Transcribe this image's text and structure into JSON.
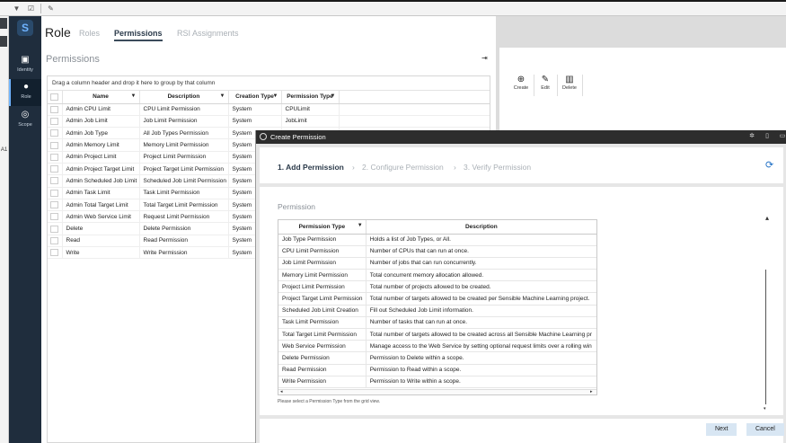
{
  "role": {
    "title": "Role",
    "tabs": [
      "Roles",
      "Permissions",
      "RSI Assignments"
    ],
    "active_tab": "Permissions",
    "section_title": "Permissions",
    "group_hint": "Drag a column header and drop it here to group by that column",
    "columns": [
      "Name",
      "Description",
      "Creation Type",
      "Permission Type"
    ],
    "rows": [
      [
        "Admin CPU Limit",
        "CPU Limit Permission",
        "System",
        "CPULimit"
      ],
      [
        "Admin Job Limit",
        "Job Limit Permission",
        "System",
        "JobLimit"
      ],
      [
        "Admin Job Type",
        "All Job Types Permission",
        "System",
        ""
      ],
      [
        "Admin Memory Limit",
        "Memory Limit Permission",
        "System",
        ""
      ],
      [
        "Admin Project Limit",
        "Project Limit Permission",
        "System",
        ""
      ],
      [
        "Admin Project Target Limit",
        "Project Target Limit Permission",
        "System",
        ""
      ],
      [
        "Admin Scheduled Job Limit",
        "Scheduled Job Limit Permission",
        "System",
        ""
      ],
      [
        "Admin Task Limit",
        "Task Limit Permission",
        "System",
        ""
      ],
      [
        "Admin Total Target Limit",
        "Total Target Limit Permission",
        "System",
        ""
      ],
      [
        "Admin Web Service Limit",
        "Request Limit Permission",
        "System",
        ""
      ],
      [
        "Delete",
        "Delete Permission",
        "System",
        ""
      ],
      [
        "Read",
        "Read Permission",
        "System",
        ""
      ],
      [
        "Write",
        "Write Permission",
        "System",
        ""
      ]
    ]
  },
  "sidebar": {
    "items": [
      {
        "label": "Identity",
        "icon": "identity-icon"
      },
      {
        "label": "Role",
        "icon": "user-icon"
      },
      {
        "label": "Scope",
        "icon": "scope-icon"
      }
    ]
  },
  "actions": {
    "create": "Create",
    "edit": "Edit",
    "delete": "Delete"
  },
  "dialog": {
    "title": "Create Permission",
    "steps": [
      "1. Add Permission",
      "2. Configure Permission",
      "3. Verify Permission"
    ],
    "section_title": "Permission",
    "columns": [
      "Permission Type",
      "Description"
    ],
    "rows": [
      [
        "Job Type Permission",
        "Holds a list of Job Types, or All."
      ],
      [
        "CPU Limit Permission",
        "Number of CPUs that can run at once."
      ],
      [
        "Job Limit Permission",
        "Number of jobs that can run concurrently."
      ],
      [
        "Memory Limit Permission",
        "Total concurrent memory allocation allowed."
      ],
      [
        "Project Limit Permission",
        "Total number of projects allowed to be created."
      ],
      [
        "Project Target Limit Permission",
        "Total number of targets allowed to be created per Sensible Machine Learning project."
      ],
      [
        "Scheduled Job Limit Creation",
        "Fill out Scheduled Job Limit information."
      ],
      [
        "Task Limit Permission",
        "Number of tasks that can run at once."
      ],
      [
        "Total Target Limit Permission",
        "Total number of targets allowed to be created across all Sensible Machine Learning pr"
      ],
      [
        "Web Service Permission",
        "Manage access to the Web Service by setting optional request limits over a rolling win"
      ],
      [
        "Delete Permission",
        "Permission to Delete within a scope."
      ],
      [
        "Read Permission",
        "Permission to Read within a scope."
      ],
      [
        "Write Permission",
        "Permission to Write within a scope."
      ]
    ],
    "hint": "Please select a Permission Type from the grid view.",
    "next": "Next",
    "cancel": "Cancel"
  },
  "leftstrip": {
    "mark": "A1"
  }
}
